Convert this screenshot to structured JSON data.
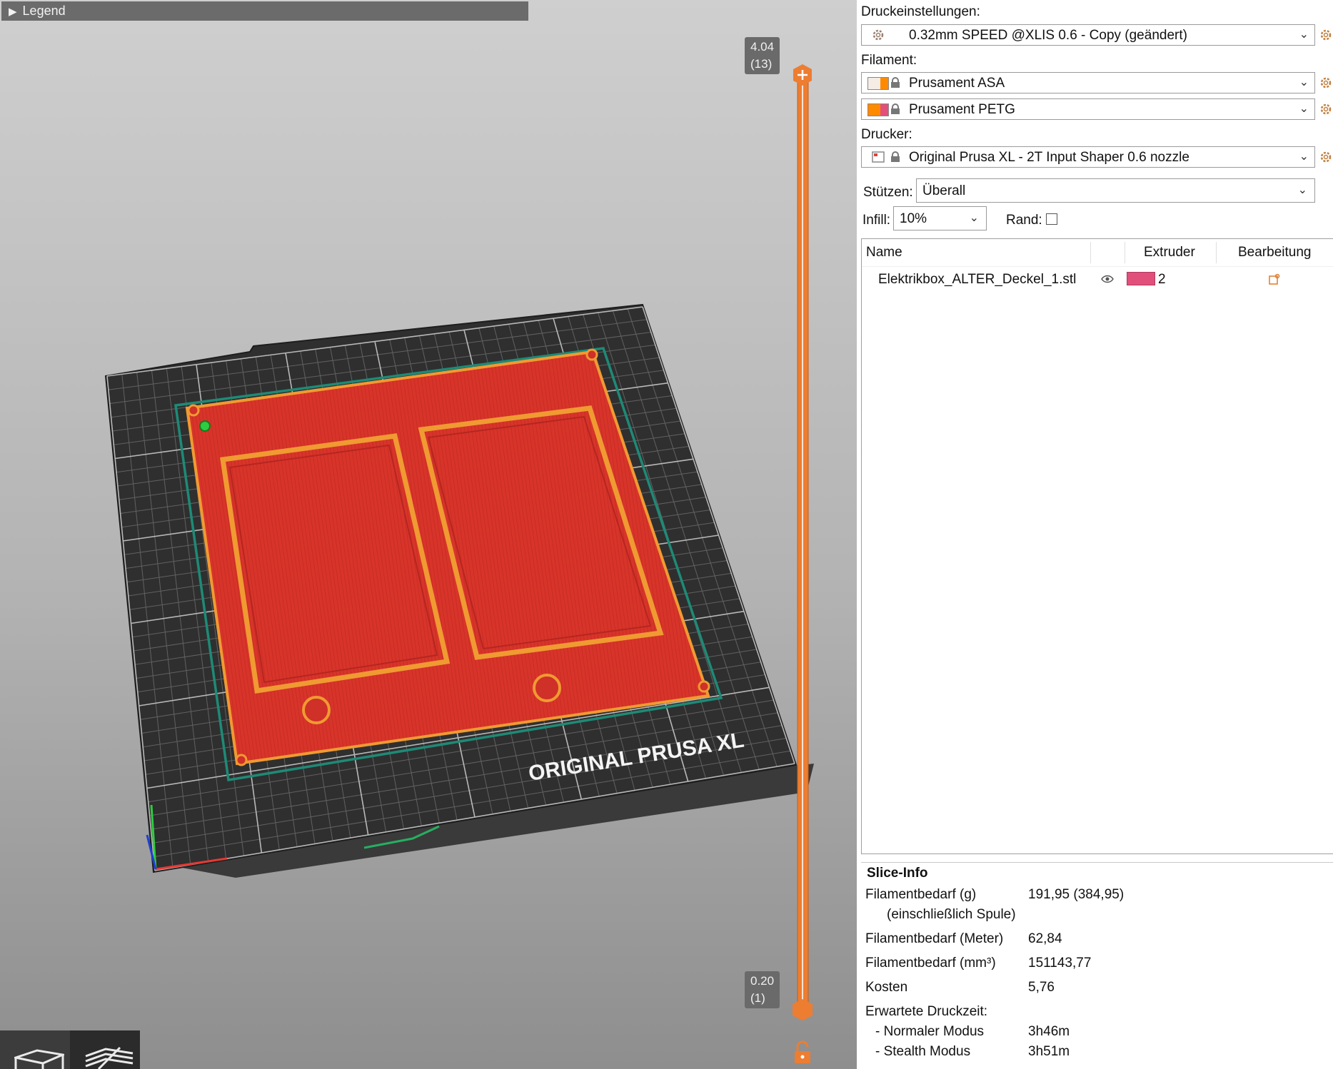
{
  "viewport": {
    "legend_label": "Legend",
    "bed_label": "ORIGINAL PRUSA XL",
    "layer_top": {
      "height": "4.04",
      "index": "(13)"
    },
    "layer_bottom": {
      "height": "0.20",
      "index": "(1)"
    }
  },
  "settings": {
    "print_label": "Druckeinstellungen:",
    "print_value": "0.32mm SPEED @XLIS 0.6 - Copy (geändert)",
    "filament_label": "Filament:",
    "filaments": [
      {
        "name": "Prusament ASA",
        "colors": [
          "#f5ece6",
          "#ff8a00"
        ]
      },
      {
        "name": "Prusament PETG",
        "colors": [
          "#ff8a00",
          "#e0507a"
        ]
      }
    ],
    "printer_label": "Drucker:",
    "printer_value": "Original Prusa XL - 2T Input Shaper 0.6 nozzle",
    "supports_label": "Stützen:",
    "supports_value": "Überall",
    "infill_label": "Infill:",
    "infill_value": "10%",
    "brim_label": "Rand:"
  },
  "object_list": {
    "headers": {
      "name": "Name",
      "extruder": "Extruder",
      "edit": "Bearbeitung"
    },
    "rows": [
      {
        "name": "Elektrikbox_ALTER_Deckel_1.stl",
        "extruder": "2",
        "extruder_color": "#e0507a"
      }
    ]
  },
  "slice_info": {
    "title": "Slice-Info",
    "rows": [
      {
        "key": "Filamentbedarf (g)",
        "value": "191,95 (384,95)"
      },
      {
        "key": "(einschließlich Spule)",
        "value": ""
      },
      {
        "key": "Filamentbedarf (Meter)",
        "value": "62,84"
      },
      {
        "key": "Filamentbedarf (mm³)",
        "value": "151143,77"
      },
      {
        "key": "Kosten",
        "value": "5,76"
      },
      {
        "key": "Erwartete Druckzeit:",
        "value": ""
      },
      {
        "key": "- Normaler Modus",
        "value": "3h46m"
      },
      {
        "key": "- Stealth Modus",
        "value": "3h51m"
      }
    ]
  },
  "colors": {
    "accent": "#ed7d31",
    "part": "#d8342a",
    "part_outline": "#f09a32",
    "skirt": "#1e8a76",
    "bed": "#2e2e2e"
  }
}
